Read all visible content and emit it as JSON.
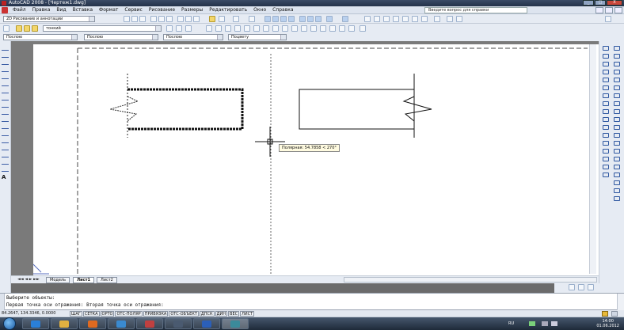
{
  "window": {
    "title": "AutoCAD 2008 - [Чертеж1.dwg]",
    "buttons": {
      "minimize": "_",
      "maximize": "□",
      "close": "X"
    }
  },
  "menu": {
    "items": [
      "Файл",
      "Правка",
      "Вид",
      "Вставка",
      "Формат",
      "Сервис",
      "Рисование",
      "Размеры",
      "Редактировать",
      "Окно",
      "Справка"
    ],
    "help_search_placeholder": "Введите вопрос для справки"
  },
  "toolbars": {
    "workspace": "2D Рисование и аннотации",
    "layer": "тонкий",
    "color": "Послою",
    "linetype": "Послою",
    "lineweight": "Послою",
    "plotstyle": "Поцвету"
  },
  "drawing": {
    "tooltip": "Полярная: 54.7858 < 270°"
  },
  "tabs": {
    "items": [
      "Модель",
      "Лист1",
      "Лист2"
    ],
    "active": "Лист1"
  },
  "command": {
    "line1": "Выберите объекты:",
    "line2": "Первая точка оси отражения: Вторая точка оси отражения:"
  },
  "status": {
    "coords": "84.2647, 134.3346, 0.0000",
    "buttons": [
      "ШАГ",
      "СЕТКА",
      "ОРТО",
      "ОТС-ПОЛЯР",
      "ПРИВЯЗКА",
      "ОТС-ОБЪЕКТ",
      "ДПСК",
      "ДИН",
      "ВЕС",
      "ЛИСТ"
    ]
  },
  "taskbar": {
    "language": "RU",
    "time": "14:00",
    "date": "01.06.2012"
  },
  "colors": {
    "titlebar": "#2b3a55",
    "accent": "#3b5da5",
    "paper": "#ffffff",
    "layout_bg": "#7a7a7a"
  }
}
